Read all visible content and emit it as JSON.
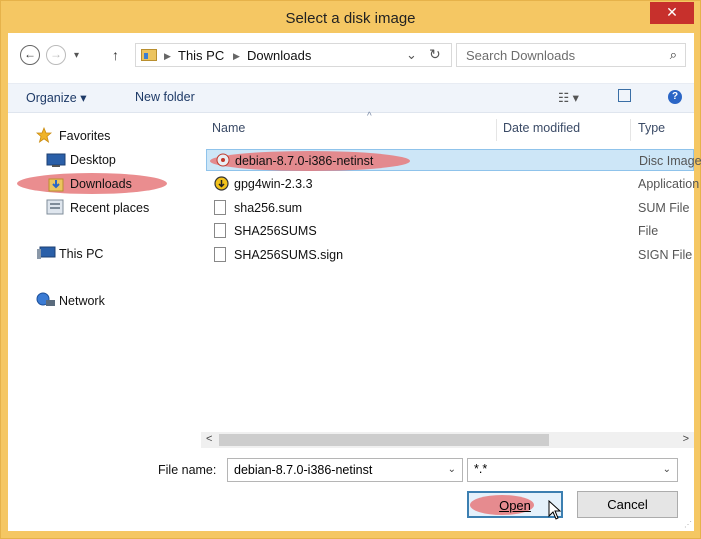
{
  "window": {
    "title": "Select a disk image",
    "close_glyph": "✕"
  },
  "nav": {
    "back_glyph": "←",
    "forward_glyph": "→",
    "dropdown_glyph": "▾",
    "up_glyph": "↑"
  },
  "address": {
    "crumbs": [
      "This PC",
      "Downloads"
    ],
    "sep_glyph": "▶",
    "dropdown_glyph": "⌄",
    "refresh_glyph": "↻"
  },
  "search": {
    "placeholder": "Search Downloads",
    "icon_glyph": "⌕"
  },
  "toolbar": {
    "organize": "Organize ▾",
    "new_folder": "New folder",
    "views_glyph": "☷ ▾",
    "help_glyph": "?"
  },
  "sidebar": {
    "favorites": "Favorites",
    "items": [
      {
        "label": "Desktop",
        "icon": "desktop-icon"
      },
      {
        "label": "Downloads",
        "icon": "downloads-icon"
      },
      {
        "label": "Recent places",
        "icon": "recent-places-icon"
      }
    ],
    "this_pc": "This PC",
    "network": "Network"
  },
  "columns": {
    "name": "Name",
    "date_modified": "Date modified",
    "type": "Type",
    "sort_glyph": "^"
  },
  "files": [
    {
      "name": "debian-8.7.0-i386-netinst",
      "type": "Disc Image",
      "icon": "disc-image-icon",
      "selected": true
    },
    {
      "name": "gpg4win-2.3.3",
      "type": "Application",
      "icon": "application-icon",
      "selected": false
    },
    {
      "name": "sha256.sum",
      "type": "SUM File",
      "icon": "file-icon",
      "selected": false
    },
    {
      "name": "SHA256SUMS",
      "type": "File",
      "icon": "file-icon",
      "selected": false
    },
    {
      "name": "SHA256SUMS.sign",
      "type": "SIGN File",
      "icon": "file-icon",
      "selected": false
    }
  ],
  "scroll": {
    "left_glyph": "<",
    "right_glyph": ">"
  },
  "bottom": {
    "file_name_label": "File name:",
    "file_name_value": "debian-8.7.0-i386-netinst",
    "filter_value": "*.*",
    "dropdown_glyph": "⌄",
    "open_label": "Open",
    "cancel_label": "Cancel"
  },
  "colors": {
    "title_bar": "#f5c763",
    "close_button": "#c7302c",
    "selection": "#cde6f7",
    "highlight_annotation": "#e6797b"
  }
}
